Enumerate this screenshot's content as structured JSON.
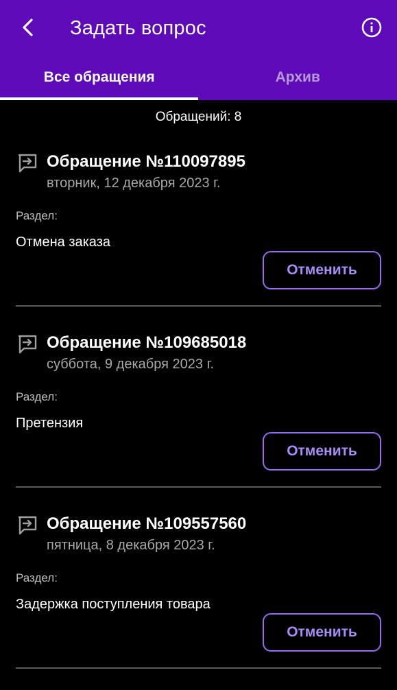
{
  "header": {
    "title": "Задать вопрос",
    "back_icon": "chevron-left-icon",
    "info_icon": "info-circle-icon",
    "background": "#5e0ab8"
  },
  "tabs": [
    {
      "label": "Все обращения",
      "active": true
    },
    {
      "label": "Архив",
      "active": false
    }
  ],
  "summary": {
    "count_text": "Обращений: 8"
  },
  "requests": [
    {
      "title": "Обращение №110097895",
      "date": "вторник, 12 декабря 2023 г.",
      "section_label": "Раздел:",
      "section_value": "Отмена заказа",
      "cancel_label": "Отменить"
    },
    {
      "title": "Обращение №109685018",
      "date": "суббота, 9 декабря 2023 г.",
      "section_label": "Раздел:",
      "section_value": "Претензия",
      "cancel_label": "Отменить"
    },
    {
      "title": "Обращение №109557560",
      "date": "пятница, 8 декабря 2023 г.",
      "section_label": "Раздел:",
      "section_value": "Задержка поступления товара",
      "cancel_label": "Отменить"
    }
  ],
  "colors": {
    "accent": "#9a6df0",
    "background": "#000000",
    "divider": "#5a5a5a"
  }
}
